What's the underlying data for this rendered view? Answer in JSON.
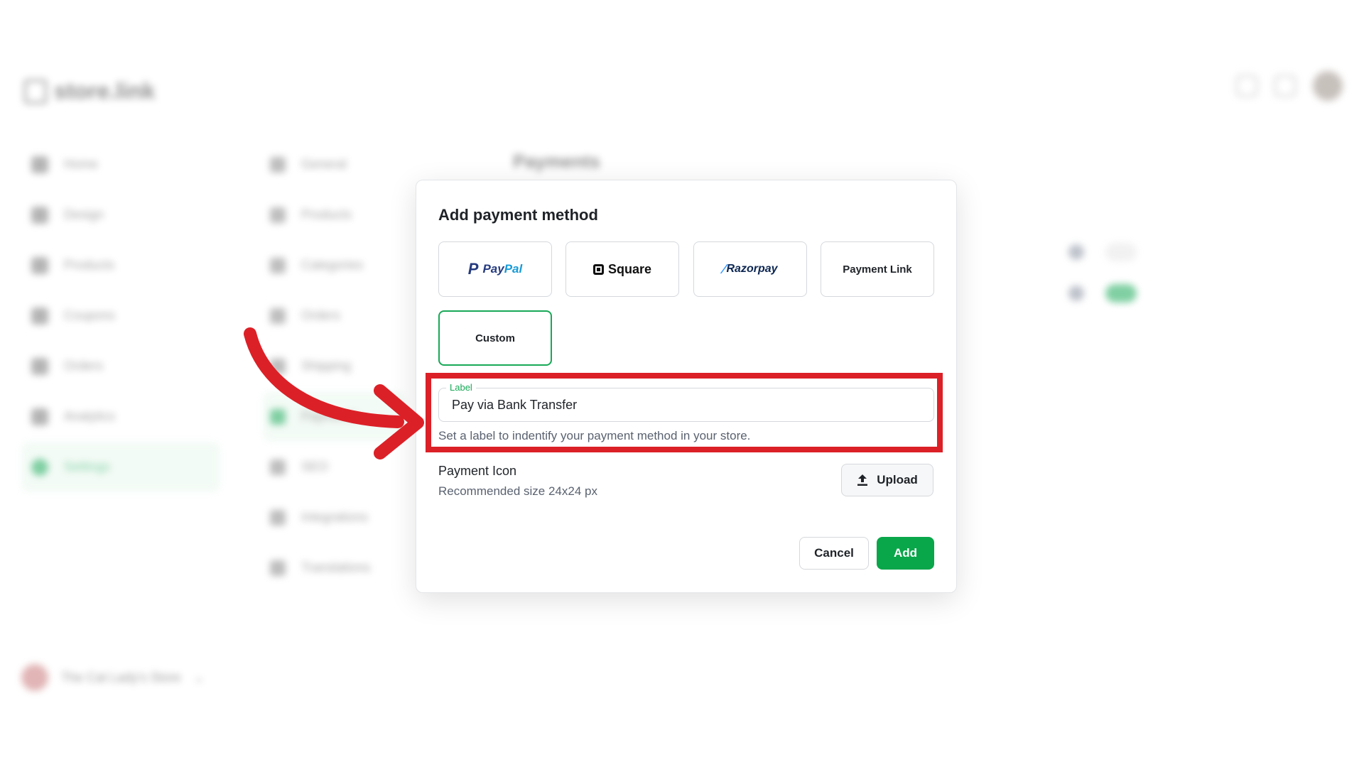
{
  "background": {
    "logo_text": "store.link",
    "page_title": "Payments",
    "nav": [
      "Home",
      "Design",
      "Products",
      "Coupons",
      "Orders",
      "Analytics",
      "Settings"
    ],
    "settings_nav": [
      "General",
      "Products",
      "Categories",
      "Orders",
      "Shipping",
      "Payments",
      "SEO",
      "Integrations",
      "Translations"
    ],
    "store_name": "The Cat Lady's Store"
  },
  "modal": {
    "title": "Add payment method",
    "providers": {
      "paypal_a": "Pay",
      "paypal_b": "Pal",
      "square": "Square",
      "razorpay": "Razorpay",
      "payment_link": "Payment Link",
      "custom": "Custom"
    },
    "selected_provider": "Custom",
    "label_field": {
      "label": "Label",
      "value": "Pay via Bank Transfer",
      "helper": "Set a label to indentify your payment method in your store."
    },
    "payment_icon": {
      "title": "Payment Icon",
      "subtitle": "Recommended size 24x24 px",
      "upload_label": "Upload"
    },
    "cancel_label": "Cancel",
    "add_label": "Add"
  },
  "colors": {
    "accent": "#18a957",
    "add_button": "#0aa64a",
    "annotation": "#dc2027"
  }
}
